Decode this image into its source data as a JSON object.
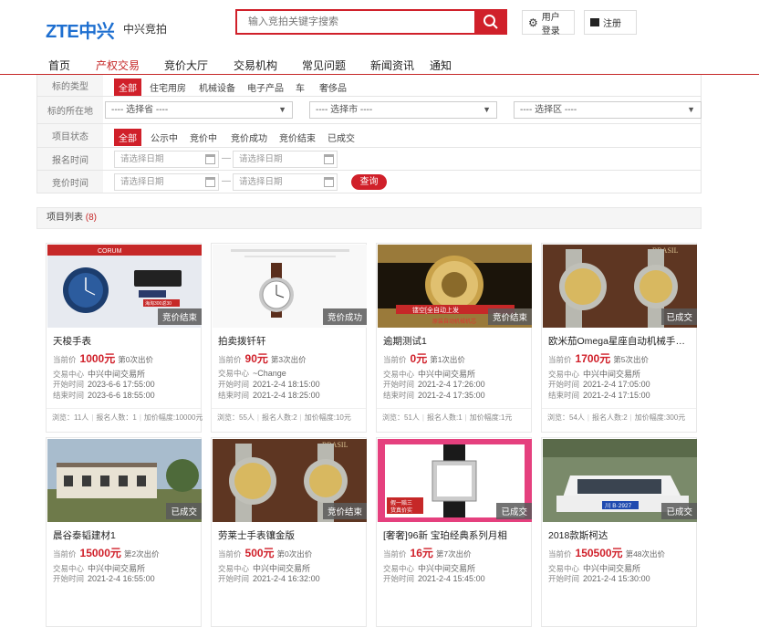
{
  "header": {
    "logo": "ZTE中兴",
    "site_name": "中兴竞拍",
    "search_placeholder": "输入竞拍关键字搜索",
    "login_label": "用户登录",
    "register_label": "注册"
  },
  "nav": [
    "首页",
    "产权交易",
    "竞价大厅",
    "交易机构",
    "常见问题",
    "新闻资讯",
    "通知"
  ],
  "filters": {
    "type_label": "标的类型",
    "type_options": [
      "全部",
      "住宅用房",
      "机械设备",
      "电子产品",
      "车",
      "奢侈品"
    ],
    "location_label": "标的所在地",
    "province_placeholder": "---- 选择省 ----",
    "city_placeholder": "---- 选择市 ----",
    "district_placeholder": "---- 选择区 ----",
    "status_label": "项目状态",
    "status_options": [
      "全部",
      "公示中",
      "竞价中",
      "竞价成功",
      "竞价结束",
      "已成交"
    ],
    "signup_time_label": "报名时间",
    "bid_time_label": "竞价时间",
    "date_placeholder": "请选择日期",
    "range_sep": "—",
    "query_label": "查询"
  },
  "list": {
    "title": "项目列表",
    "count": "(8)"
  },
  "labels": {
    "current_price": "当前价",
    "center": "交易中心",
    "start_time": "开始时间",
    "end_time": "结束时间"
  },
  "cards": [
    {
      "title": "天梭手表",
      "price": "1000元",
      "bids": "第0次出价",
      "center": "中兴中间交易所",
      "start": "2023-6-6 17:55:00",
      "end": "2023-6-6 18:55:00",
      "badge": "竞价结束",
      "views": "浏览：11人",
      "signups": "报名人数：1",
      "increment": "加价幅度:10000元"
    },
    {
      "title": "拍卖拨钎轩",
      "price": "90元",
      "bids": "第3次出价",
      "center": "~Change",
      "start": "2021-2-4 18:15:00",
      "end": "2021-2-4 18:25:00",
      "badge": "竞价成功",
      "views": "浏览：55人",
      "signups": "报名人数:2",
      "increment": "加价幅度:10元"
    },
    {
      "title": "逾期测试1",
      "price": "0元",
      "bids": "第1次出价",
      "center": "中兴中间交易所",
      "start": "2021-2-4 17:26:00",
      "end": "2021-2-4 17:35:00",
      "badge": "竞价结束",
      "views": "浏览：51人",
      "signups": "报名人数:1",
      "increment": "加价幅度:1元"
    },
    {
      "title": "欧米茄Omega星座自动机械手表...",
      "price": "1700元",
      "bids": "第5次出价",
      "center": "中兴中间交易所",
      "start": "2021-2-4 17:05:00",
      "end": "2021-2-4 17:15:00",
      "badge": "已成交",
      "views": "浏览：54人",
      "signups": "报名人数:2",
      "increment": "加价幅度:300元"
    },
    {
      "title": "晨谷泰韬建材1",
      "price": "15000元",
      "bids": "第2次出价",
      "center": "中兴中间交易所",
      "start": "2021-2-4 16:55:00",
      "end": "",
      "badge": "已成交",
      "views": "",
      "signups": "",
      "increment": ""
    },
    {
      "title": "劳莱士手表镶金版",
      "price": "500元",
      "bids": "第0次出价",
      "center": "中兴中间交易所",
      "start": "2021-2-4 16:32:00",
      "end": "",
      "badge": "竞价结束",
      "views": "",
      "signups": "",
      "increment": ""
    },
    {
      "title": "[奢奢]96新 宝珀经典系列月相",
      "price": "16元",
      "bids": "第7次出价",
      "center": "中兴中间交易所",
      "start": "2021-2-4 15:45:00",
      "end": "",
      "badge": "已成交",
      "views": "",
      "signups": "",
      "increment": ""
    },
    {
      "title": "2018款斯柯达",
      "price": "150500元",
      "bids": "第48次出价",
      "center": "中兴中间交易所",
      "start": "2021-2-4 15:30:00",
      "end": "",
      "badge": "已成交",
      "views": "",
      "signups": "",
      "increment": ""
    }
  ],
  "image_text": {
    "card1_header": "CORUM",
    "card1_banner": "海淘300返30",
    "card3_banner": "镂空[全自动上发",
    "card3_sub": "原装自动机械机芯",
    "card4_brand": "BRASIL",
    "card6_brand": "BRASIL",
    "card7_tag1": "假一赔三",
    "card7_tag2": "货真价实",
    "card8_plate": "川 B·2927"
  },
  "colors": {
    "brand_red": "#d0202a",
    "logo_blue": "#1e6fd0"
  }
}
